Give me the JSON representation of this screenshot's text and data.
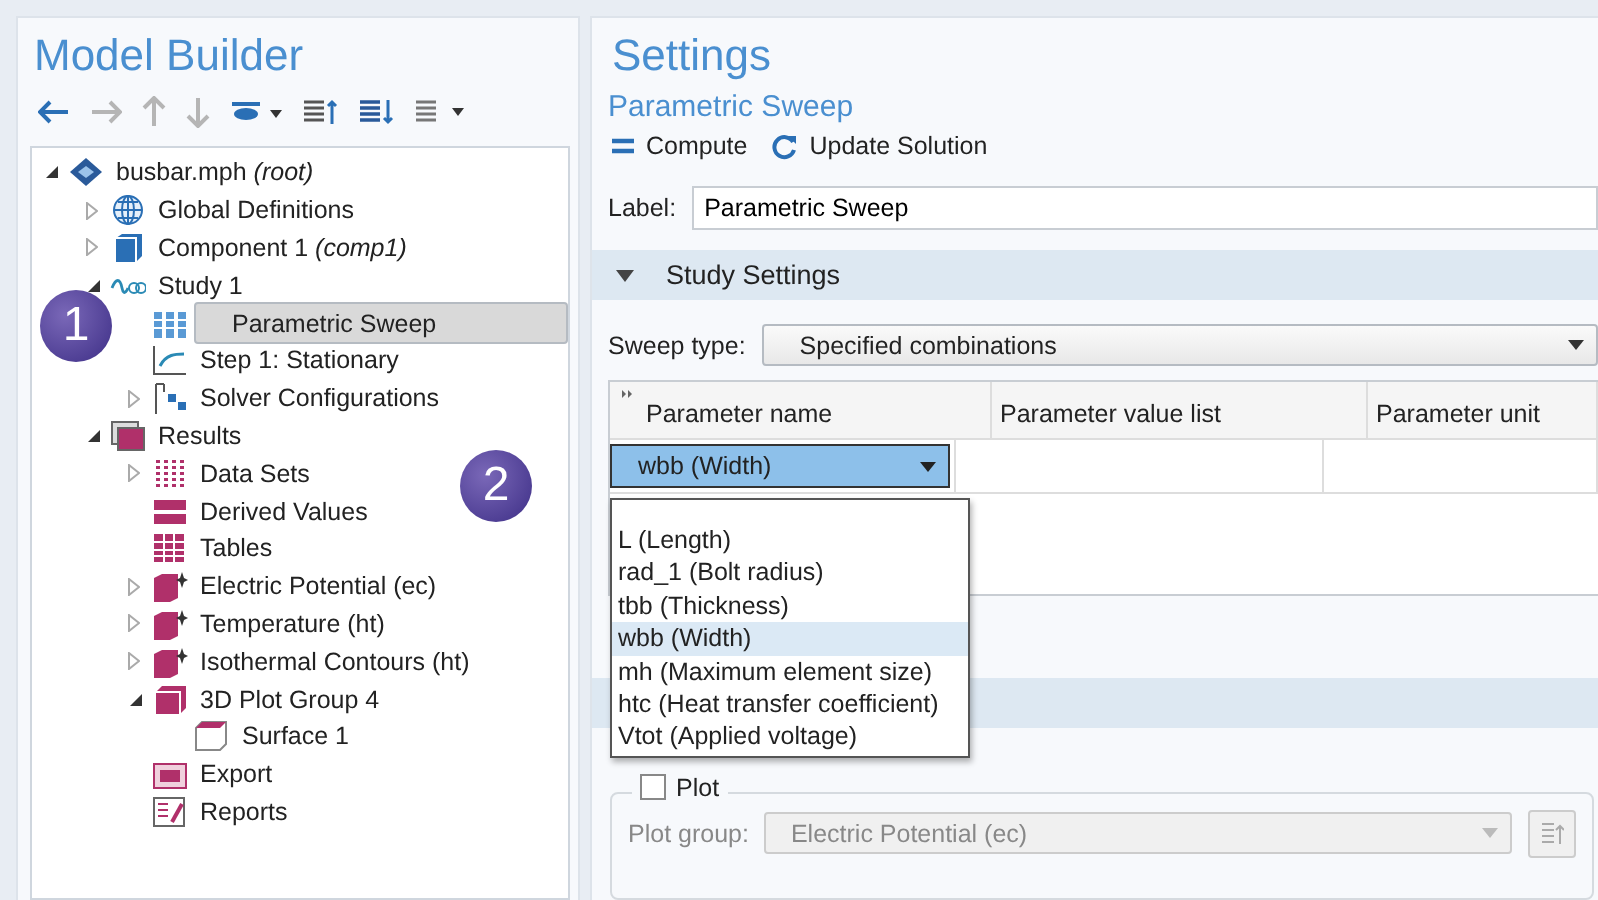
{
  "model_builder": {
    "title": "Model Builder",
    "tree": [
      {
        "label": "busbar.mph *(root)*",
        "kind": "root",
        "expanded": true,
        "selected": false,
        "children": [
          {
            "label": "Global Definitions",
            "kind": "globe",
            "expanded": false,
            "selected": false
          },
          {
            "label": "Component 1 *(comp1)*",
            "kind": "component",
            "expanded": false,
            "selected": false
          },
          {
            "label": "Study 1",
            "kind": "study",
            "expanded": true,
            "selected": false,
            "children": [
              {
                "label": "Parametric Sweep",
                "kind": "sweep",
                "selected": true
              },
              {
                "label": "Step 1: Stationary",
                "kind": "step",
                "selected": false
              },
              {
                "label": "Solver Configurations",
                "kind": "solver",
                "expanded": false,
                "selected": false
              }
            ]
          },
          {
            "label": "Results",
            "kind": "results",
            "expanded": true,
            "selected": false,
            "children": [
              {
                "label": "Data Sets",
                "kind": "datasets",
                "expanded": false,
                "selected": false
              },
              {
                "label": "Derived Values",
                "kind": "derived",
                "selected": false
              },
              {
                "label": "Tables",
                "kind": "tables",
                "selected": false
              },
              {
                "label": "Electric Potential (ec)",
                "kind": "plot",
                "expanded": false,
                "selected": false
              },
              {
                "label": "Temperature (ht)",
                "kind": "plot",
                "expanded": false,
                "selected": false
              },
              {
                "label": "Isothermal Contours (ht)",
                "kind": "plot",
                "expanded": false,
                "selected": false
              },
              {
                "label": "3D Plot Group 4",
                "kind": "plotgroup",
                "expanded": true,
                "selected": false,
                "children": [
                  {
                    "label": "Surface 1",
                    "kind": "surface",
                    "selected": false
                  }
                ]
              },
              {
                "label": "Export",
                "kind": "export",
                "selected": false
              },
              {
                "label": "Reports",
                "kind": "reports",
                "selected": false
              }
            ]
          }
        ]
      }
    ]
  },
  "callouts": [
    {
      "text": "1"
    },
    {
      "text": "2"
    }
  ],
  "settings": {
    "title": "Settings",
    "subtitle": "Parametric Sweep",
    "actions": [
      {
        "label": "Compute",
        "kind": "compute"
      },
      {
        "label": "Update Solution",
        "kind": "update"
      }
    ],
    "label_field": {
      "label": "Label:",
      "value": "Parametric Sweep"
    },
    "section": {
      "title": "Study Settings",
      "expanded": true
    },
    "sweep_type": {
      "label": "Sweep type:",
      "value": "Specified combinations"
    },
    "table": {
      "columns": [
        "Parameter name",
        "Parameter value list",
        "Parameter unit"
      ],
      "cell_value": "wbb (Width)",
      "options": [
        {
          "label": "L (Length)",
          "selected": false
        },
        {
          "label": "rad_1 (Bolt radius)",
          "selected": false
        },
        {
          "label": "tbb (Thickness)",
          "selected": false
        },
        {
          "label": "wbb (Width)",
          "selected": true
        },
        {
          "label": "mh (Maximum element size)",
          "selected": false
        },
        {
          "label": "htc (Heat transfer coefficient)",
          "selected": false
        },
        {
          "label": "Vtot (Applied voltage)",
          "selected": false
        }
      ]
    },
    "plot": {
      "label": "Plot",
      "checked": false,
      "group_label": "Plot group:",
      "group_value": "Electric Potential (ec)",
      "disabled": true
    }
  }
}
